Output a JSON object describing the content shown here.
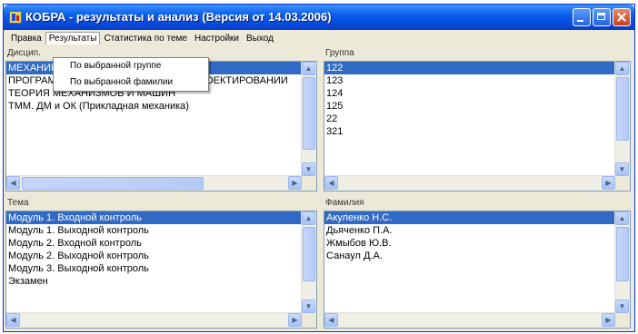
{
  "window": {
    "title": "КОБРА - результаты и анализ (Версия от 14.03.2006)"
  },
  "menu": {
    "items": [
      "Правка",
      "Результаты",
      "Статистика по теме",
      "Настройки",
      "Выход"
    ],
    "active_index": 1,
    "dropdown": [
      "По выбранной группе",
      "По выбранной фамилии"
    ]
  },
  "discipline": {
    "label": "Дисцип.",
    "items": [
      "МЕХАНИКА",
      "ПРОГРАММНОЕ ОБЕСПЕЧЕНИЕ ПРИ ПРОЕКТИРОВАНИИ",
      "ТЕОРИЯ МЕХАНИЗМОВ И МАШИН",
      "ТММ. ДМ и ОК (Прикладная механика)"
    ],
    "selected_index": 0
  },
  "group": {
    "label": "Группа",
    "items": [
      "122",
      "123",
      "124",
      "125",
      "22",
      "321"
    ],
    "selected_index": 0
  },
  "topic": {
    "label": "Тема",
    "items": [
      "Модуль 1. Входной контроль",
      "Модуль 1. Выходной контроль",
      "Модуль 2. Входной контроль",
      "Модуль 2. Выходной контроль",
      "Модуль 3. Выходной контроль",
      "Экзамен"
    ],
    "selected_index": 0
  },
  "surname": {
    "label": "Фамилия",
    "items": [
      "Акуленко Н.С.",
      "Дьяченко П.А.",
      "Жмыбов Ю.В.",
      "Санаул Д.А."
    ],
    "selected_index": 0
  },
  "icons": {
    "app": "app-icon",
    "minimize": "minimize-icon",
    "maximize": "maximize-icon",
    "close": "close-icon",
    "scroll_up": "arrow-up-icon",
    "scroll_down": "arrow-down-icon",
    "scroll_left": "arrow-left-icon",
    "scroll_right": "arrow-right-icon"
  },
  "colors": {
    "selection": "#316ac5",
    "titlebar": "#0846d8",
    "window_bg": "#ece9d8"
  }
}
